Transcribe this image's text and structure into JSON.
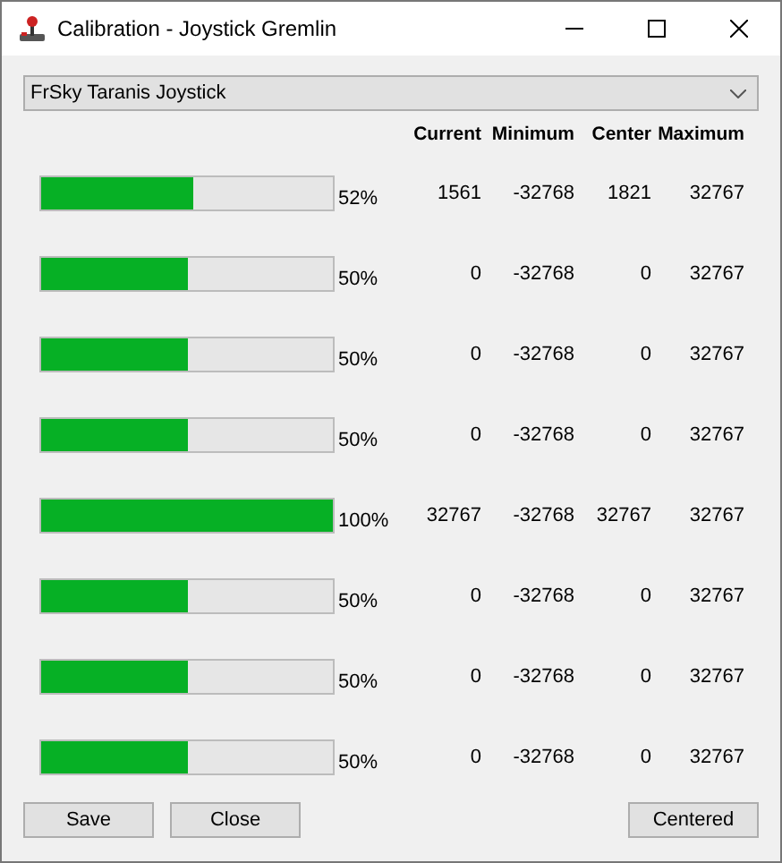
{
  "window": {
    "title": "Calibration - Joystick Gremlin"
  },
  "device_select": {
    "value": "FrSky Taranis Joystick"
  },
  "columns": [
    "Current",
    "Minimum",
    "Center",
    "Maximum"
  ],
  "axes": [
    {
      "level": 0.52,
      "percent": "52%",
      "current": "1561",
      "minimum": "-32768",
      "center": "1821",
      "maximum": "32767"
    },
    {
      "level": 0.5,
      "percent": "50%",
      "current": "0",
      "minimum": "-32768",
      "center": "0",
      "maximum": "32767"
    },
    {
      "level": 0.5,
      "percent": "50%",
      "current": "0",
      "minimum": "-32768",
      "center": "0",
      "maximum": "32767"
    },
    {
      "level": 0.5,
      "percent": "50%",
      "current": "0",
      "minimum": "-32768",
      "center": "0",
      "maximum": "32767"
    },
    {
      "level": 1,
      "percent": "100%",
      "current": "32767",
      "minimum": "-32768",
      "center": "32767",
      "maximum": "32767"
    },
    {
      "level": 0.5,
      "percent": "50%",
      "current": "0",
      "minimum": "-32768",
      "center": "0",
      "maximum": "32767"
    },
    {
      "level": 0.5,
      "percent": "50%",
      "current": "0",
      "minimum": "-32768",
      "center": "0",
      "maximum": "32767"
    },
    {
      "level": 0.5,
      "percent": "50%",
      "current": "0",
      "minimum": "-32768",
      "center": "0",
      "maximum": "32767"
    }
  ],
  "buttons_left": [
    "Save",
    "Close"
  ],
  "buttons_right": [
    "Centered"
  ]
}
